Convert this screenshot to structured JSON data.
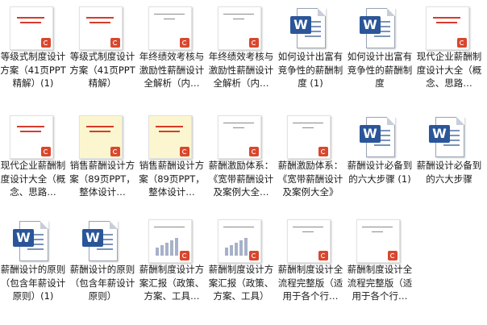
{
  "files": [
    {
      "label": "等级式制度设计方案（41页PPT精解）(1)",
      "thumb": "doc-red"
    },
    {
      "label": "等级式制度设计方案（41页PPT精解）",
      "thumb": "doc-red"
    },
    {
      "label": "年终绩效考核与激励性薪酬设计全解析（内…",
      "thumb": "doc-plain"
    },
    {
      "label": "年终绩效考核与激励性薪酬设计全解析（内…",
      "thumb": "doc-plain"
    },
    {
      "label": "如何设计出富有竞争性的薪酬制度 (1)",
      "thumb": "word"
    },
    {
      "label": "如何设计出富有竞争性的薪酬制度",
      "thumb": "word"
    },
    {
      "label": "现代企业薪酬制度设计大全（概念、思路…",
      "thumb": "doc-red"
    },
    {
      "label": "现代企业薪酬制度设计大全（概念、思路…",
      "thumb": "doc-red"
    },
    {
      "label": "销售薪酬设计方案（89页PPT，整体设计…",
      "thumb": "doc-yellow"
    },
    {
      "label": "销售薪酬设计方案（89页PPT，整体设计…",
      "thumb": "doc-yellow"
    },
    {
      "label": "薪酬激励体系：《宽带薪酬设计及案例大全…",
      "thumb": "doc-plain"
    },
    {
      "label": "薪酬激励体系：《宽带薪酬设计及案例大全》",
      "thumb": "doc-plain"
    },
    {
      "label": "薪酬设计必备到的六大步骤 (1)",
      "thumb": "word"
    },
    {
      "label": "薪酬设计必备到的六大步骤",
      "thumb": "word"
    },
    {
      "label": "薪酬设计的原则（包含年薪设计原则）(1)",
      "thumb": "word"
    },
    {
      "label": "薪酬设计的原则（包含年薪设计原则）",
      "thumb": "word"
    },
    {
      "label": "薪酬制度设计方案汇报（政策、方案、工具…",
      "thumb": "doc-chart"
    },
    {
      "label": "薪酬制度设计方案汇报（政策、方案、工具）",
      "thumb": "doc-chart"
    },
    {
      "label": "薪酬制度设计全流程完整版（适用于各个行…",
      "thumb": "doc-plain"
    },
    {
      "label": "薪酬制度设计全流程完整版（适用于各个行…",
      "thumb": "doc-plain"
    }
  ],
  "icons": {
    "doc": "document-icon",
    "word": "word-document-icon"
  },
  "colors": {
    "accent_red": "#d63b2c",
    "word_blue": "#2a5699"
  }
}
